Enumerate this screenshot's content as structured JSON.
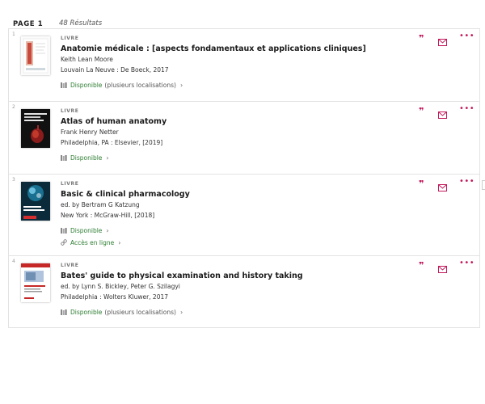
{
  "header": {
    "page_label": "PAGE 1",
    "results_count": "48 Résultats"
  },
  "colors": {
    "available": "#2e7d32",
    "action_accent": "#c2185b"
  },
  "icons": {
    "cite": "quote-icon",
    "email": "mail-icon",
    "more": "more-options-icon",
    "availability": "book-shelf-icon",
    "online": "link-icon",
    "expand": "chevron-right-icon"
  },
  "results": [
    {
      "index": "1",
      "type": "LIVRE",
      "title": "Anatomie médicale : [aspects fondamentaux et applications cliniques]",
      "author": "Keith Lean Moore",
      "publisher": "Louvain La Neuve : De Boeck, 2017",
      "availability": "Disponible",
      "availability_extra": "(plusieurs localisations)",
      "chevron": "›"
    },
    {
      "index": "2",
      "type": "LIVRE",
      "title": "Atlas of human anatomy",
      "author": "Frank Henry Netter",
      "publisher": "Philadelphia, PA : Elsevier, [2019]",
      "availability": "Disponible",
      "chevron": "›"
    },
    {
      "index": "3",
      "type": "LIVRE",
      "title": "Basic & clinical pharmacology",
      "author": "ed. by Bertram G Katzung",
      "publisher": "New York : McGraw-Hill, [2018]",
      "availability": "Disponible",
      "online": "Accès en ligne",
      "chevron": "›"
    },
    {
      "index": "4",
      "type": "LIVRE",
      "title": "Bates' guide to physical examination and history taking",
      "author": "ed. by Lynn S. Bickley, Peter G. Szilagyi",
      "publisher": "Philadelphia : Wolters Kluwer, 2017",
      "availability": "Disponible",
      "availability_extra": "(plusieurs localisations)",
      "chevron": "›"
    }
  ]
}
